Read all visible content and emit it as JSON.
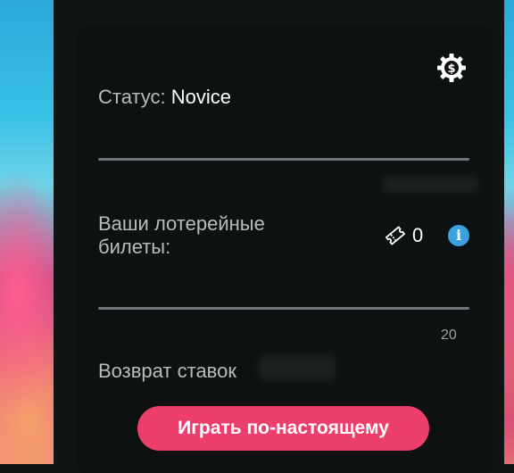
{
  "status": {
    "label": "Статус:",
    "value": "Novice"
  },
  "tickets": {
    "label": "Ваши лотерейные билеты:",
    "count": "0"
  },
  "progress": {
    "max": "20",
    "value": 0
  },
  "bet_return": {
    "label": "Возврат ставок"
  },
  "play_button": {
    "label": "Играть по-настоящему"
  },
  "colors": {
    "accent": "#ec3f6c",
    "info": "#3aa3df",
    "panel": "#0d1111"
  },
  "icons": {
    "settings": "gear-dollar-icon",
    "ticket": "ticket-icon",
    "info": "info-icon"
  }
}
